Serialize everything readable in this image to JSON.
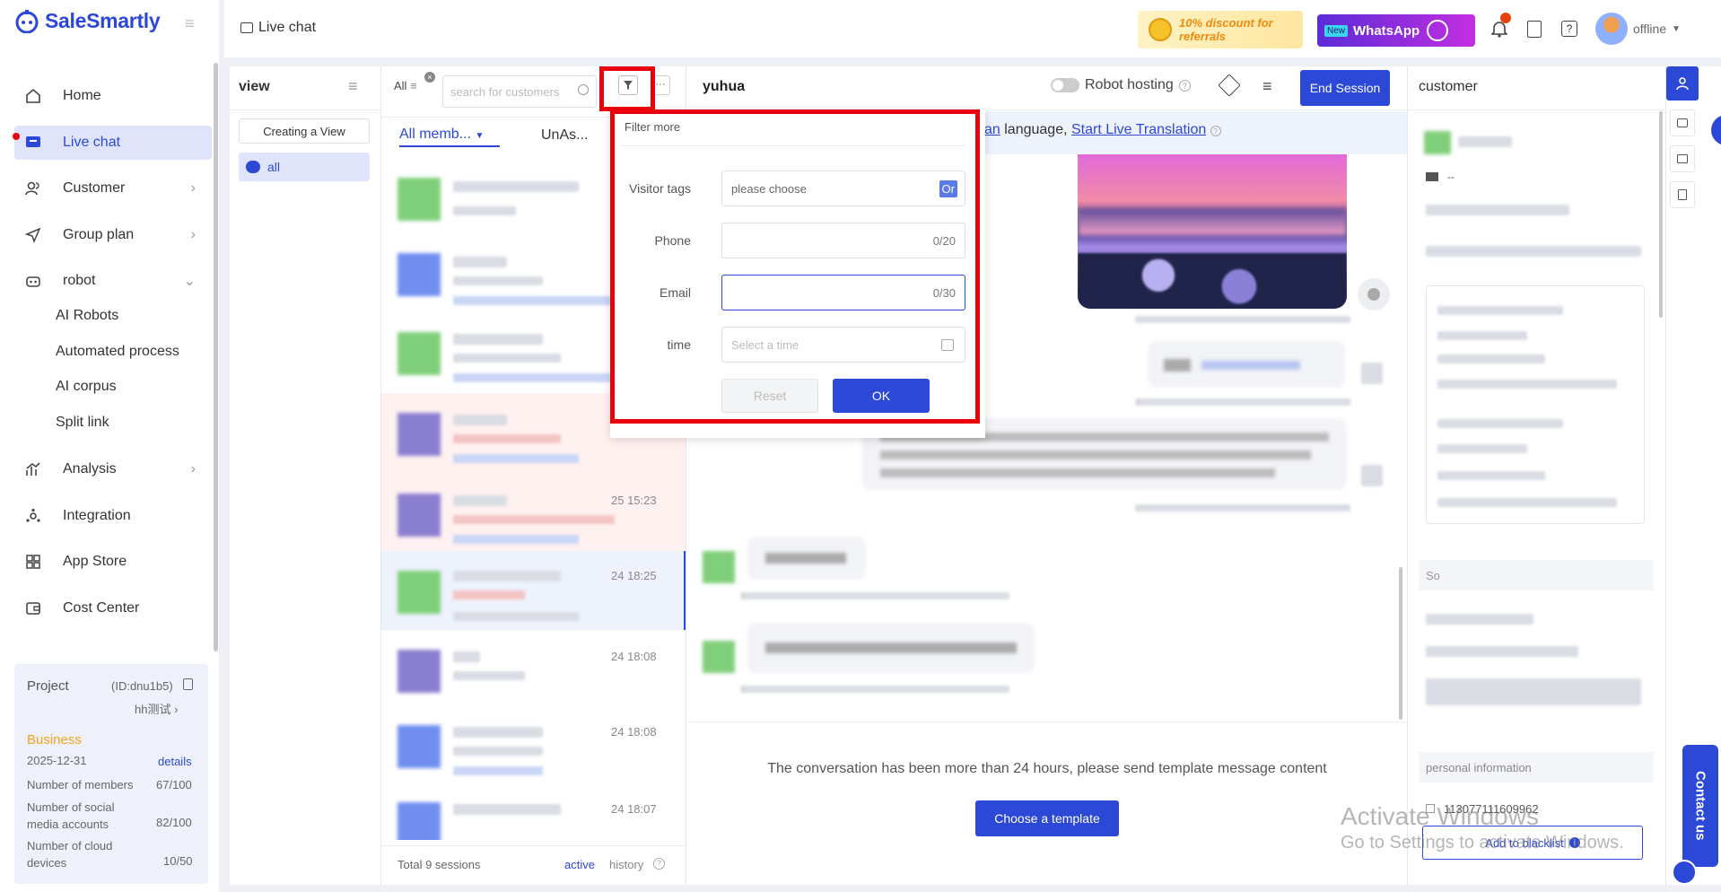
{
  "app": {
    "name": "SaleSmartly"
  },
  "sidebar": {
    "items": [
      {
        "label": "Home",
        "icon": "home-icon"
      },
      {
        "label": "Live chat",
        "icon": "chat-icon"
      },
      {
        "label": "Customer",
        "icon": "users-icon"
      },
      {
        "label": "Group plan",
        "icon": "send-icon"
      },
      {
        "label": "robot",
        "icon": "robot-icon"
      },
      {
        "label": "Analysis",
        "icon": "analysis-icon"
      },
      {
        "label": "Integration",
        "icon": "integration-icon"
      },
      {
        "label": "App Store",
        "icon": "app-store-icon"
      },
      {
        "label": "Cost Center",
        "icon": "wallet-icon"
      }
    ],
    "robot_sub": [
      "AI Robots",
      "Automated process",
      "AI corpus",
      "Split link"
    ]
  },
  "project": {
    "label": "Project",
    "id": "(ID:dnu1b5)",
    "name": "hh测试",
    "plan": "Business",
    "date": "2025-12-31",
    "details": "details",
    "members_label": "Number of members",
    "members_value": "67/100",
    "social_label": "Number of social media accounts",
    "social_value": "82/100",
    "cloud_label": "Number of cloud devices",
    "cloud_value": "10/50"
  },
  "topbar": {
    "title": "Live chat",
    "promo": "10% discount for referrals",
    "new_badge": "New",
    "whatsapp": "WhatsApp",
    "status": "offline"
  },
  "views": {
    "title": "view",
    "create": "Creating a View",
    "all": "all"
  },
  "list": {
    "all_tab": "All",
    "search_placeholder": "search for customers",
    "tab_members": "All memb...",
    "tab_unassigned": "UnAs...",
    "times": [
      "25 15:23",
      "24 18:25",
      "24 18:08",
      "24 18:08",
      "24 18:07"
    ],
    "total": "Total 9 sessions",
    "active": "active",
    "history": "history"
  },
  "filter": {
    "title": "Filter more",
    "visitor_tags": "Visitor tags",
    "visitor_placeholder": "please choose",
    "or": "Or",
    "phone": "Phone",
    "phone_count": "0/20",
    "email": "Email",
    "email_count": "0/30",
    "time": "time",
    "time_placeholder": "Select a time",
    "reset": "Reset",
    "ok": "OK"
  },
  "chat": {
    "name": "yuhua",
    "robot_hosting": "Robot hosting",
    "end_session": "End Session",
    "translate_link_part": "an",
    "translate_text": " language, ",
    "start_translation": "Start Live Translation",
    "notice": "The conversation has been more than 24 hours, please send template message content",
    "choose_template": "Choose a template"
  },
  "customer": {
    "title": "customer",
    "dash": "--",
    "so": "So",
    "personal_info": "personal information",
    "phone_number": "113077111609962",
    "blacklist": "Add to blacklist"
  },
  "watermark": {
    "line1": "Activate Windows",
    "line2": "Go to Settings to activate Windows."
  },
  "contact_us": "Contact us",
  "colors": {
    "brand": "#2b48d6",
    "highlight": "#e8000b",
    "active_bg": "#dfe4fb",
    "promo": "#f7a21b"
  }
}
